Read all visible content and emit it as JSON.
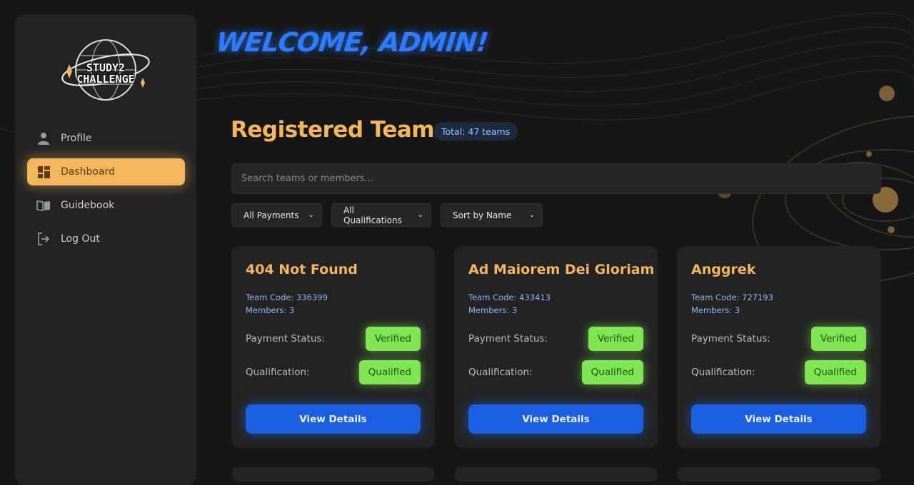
{
  "brand": {
    "logo_line1": "STUDY2",
    "logo_line2": "CHALLENGE"
  },
  "sidebar": {
    "items": [
      {
        "label": "Profile",
        "icon": "user-icon",
        "active": false
      },
      {
        "label": "Dashboard",
        "icon": "dashboard-icon",
        "active": true
      },
      {
        "label": "Guidebook",
        "icon": "book-icon",
        "active": false
      },
      {
        "label": "Log Out",
        "icon": "logout-icon",
        "active": false
      }
    ]
  },
  "header": {
    "welcome": "WELCOME, ADMIN!"
  },
  "main": {
    "title": "Registered Teams",
    "total_badge": "Total: 47 teams",
    "search_placeholder": "Search teams or members...",
    "filters": {
      "payment": "All Payments",
      "qualification": "All Qualifications",
      "sort": "Sort by Name"
    },
    "cards": [
      {
        "name": "404 Not Found",
        "code": "Team Code: 336399",
        "members": "Members: 3",
        "payment_label": "Payment Status:",
        "payment": "Verified",
        "qual_label": "Qualification:",
        "qualification": "Qualified",
        "button": "View Details"
      },
      {
        "name": "Ad Maiorem Dei Gloriam",
        "code": "Team Code: 433413",
        "members": "Members: 3",
        "payment_label": "Payment Status:",
        "payment": "Verified",
        "qual_label": "Qualification:",
        "qualification": "Qualified",
        "button": "View Details"
      },
      {
        "name": "Anggrek",
        "code": "Team Code: 727193",
        "members": "Members: 3",
        "payment_label": "Payment Status:",
        "payment": "Verified",
        "qual_label": "Qualification:",
        "qualification": "Qualified",
        "button": "View Details"
      }
    ]
  },
  "colors": {
    "accent_gold": "#f5b45e",
    "accent_blue": "#2f7bff",
    "status_green": "#7fe552",
    "button_blue": "#1b5fe0"
  }
}
